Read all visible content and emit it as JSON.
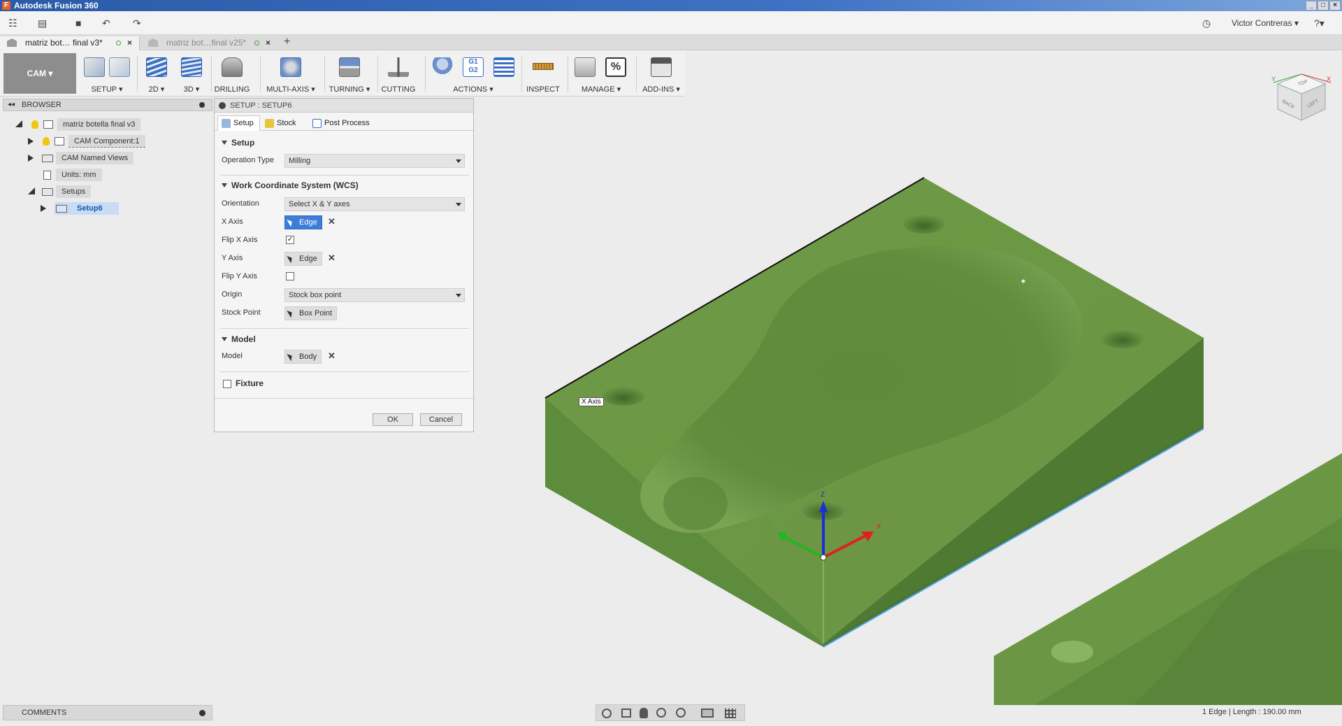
{
  "window": {
    "title": "Autodesk Fusion 360",
    "app_icon_letter": "F",
    "min": "_",
    "max": "□",
    "close": "×"
  },
  "quickbar": {
    "grid_icon": "☷",
    "file_icon": "▤",
    "save_icon": "■",
    "undo_icon": "↶",
    "redo_icon": "↷",
    "clock_icon": "◷",
    "user": "Victor Contreras ▾",
    "help_icon": "?▾"
  },
  "doctabs": [
    {
      "label": "matriz bot… final v3*",
      "close": "×"
    },
    {
      "label": "matriz bot…final v25*",
      "close": "×"
    }
  ],
  "doctabs_new": "+",
  "ribbon": {
    "workspace": "CAM ▾",
    "groups": [
      "SETUP ▾",
      "2D ▾",
      "3D ▾",
      "DRILLING",
      "MULTI-AXIS ▾",
      "TURNING ▾",
      "CUTTING",
      "ACTIONS ▾",
      "INSPECT",
      "MANAGE ▾",
      "ADD-INS ▾"
    ],
    "g1g2_top": "G1",
    "g1g2_bottom": "G2",
    "manage_percent": "%"
  },
  "viewcube": {
    "faces": [
      "TOP",
      "BACK",
      "LEFT"
    ],
    "axis_x": "X",
    "axis_y": "Y"
  },
  "browser": {
    "title": "BROWSER",
    "items": [
      {
        "label": "matriz botella final v3"
      },
      {
        "label": "CAM Component:1"
      },
      {
        "label": "CAM Named Views"
      },
      {
        "label": "Units: mm"
      },
      {
        "label": "Setups"
      },
      {
        "label": "Setup6"
      }
    ]
  },
  "dialog": {
    "title": "SETUP : SETUP6",
    "tabs": [
      "Setup",
      "Stock",
      "Post Process"
    ],
    "setup_section": "Setup",
    "operation_type_label": "Operation Type",
    "operation_type_value": "Milling",
    "wcs_section": "Work Coordinate System (WCS)",
    "orientation_label": "Orientation",
    "orientation_value": "Select X & Y axes",
    "x_axis_label": "X Axis",
    "x_axis_value": "Edge",
    "flip_x_label": "Flip X Axis",
    "flip_x_checked": true,
    "y_axis_label": "Y Axis",
    "y_axis_value": "Edge",
    "flip_y_label": "Flip Y Axis",
    "flip_y_checked": false,
    "origin_label": "Origin",
    "origin_value": "Stock box point",
    "stock_point_label": "Stock Point",
    "stock_point_value": "Box Point",
    "model_section": "Model",
    "model_label": "Model",
    "model_value": "Body",
    "fixture_label": "Fixture",
    "fixture_checked": false,
    "ok": "OK",
    "cancel": "Cancel",
    "clear_icon": "✕",
    "check_icon": "✓"
  },
  "viewport": {
    "tooltip": "X Axis",
    "triad": {
      "x": "X",
      "y": "Y",
      "z": "Z"
    },
    "colors": {
      "stock": "#6e9a46",
      "stock_side": "#4f7a32",
      "stock_front": "#5a8a3a",
      "edge_highlight": "#4da3e8"
    }
  },
  "comments": {
    "title": "COMMENTS"
  },
  "status": {
    "message": "1 Edge | Length : 190.00 mm"
  },
  "navbar": {
    "icons": [
      "orbit-icon",
      "look-at-icon",
      "pan-icon",
      "zoom-window-icon",
      "zoom-icon",
      "display-icon",
      "grid-icon"
    ]
  }
}
